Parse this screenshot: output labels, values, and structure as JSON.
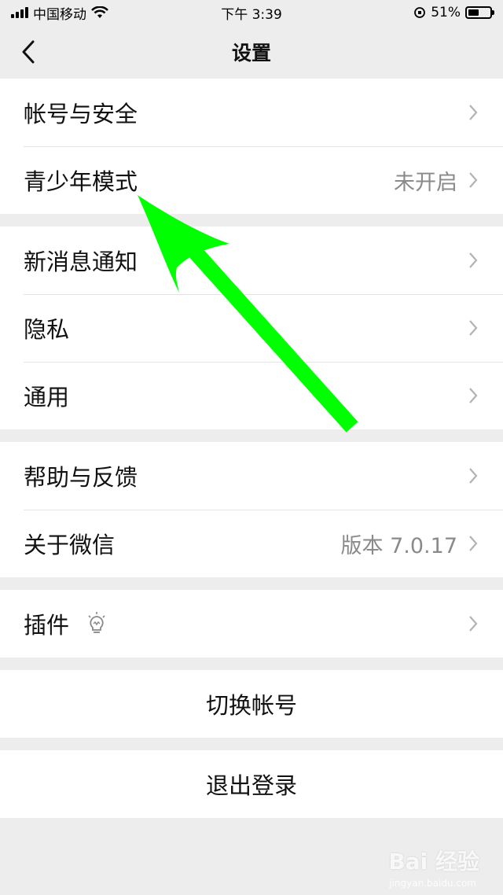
{
  "status_bar": {
    "carrier": "中国移动",
    "time": "下午 3:39",
    "battery_percent": "51%",
    "battery_level": 0.51
  },
  "nav": {
    "title": "设置"
  },
  "groups": [
    {
      "items": [
        {
          "label": "帐号与安全",
          "value": ""
        },
        {
          "label": "青少年模式",
          "value": "未开启"
        }
      ]
    },
    {
      "items": [
        {
          "label": "新消息通知",
          "value": ""
        },
        {
          "label": "隐私",
          "value": ""
        },
        {
          "label": "通用",
          "value": ""
        }
      ]
    },
    {
      "items": [
        {
          "label": "帮助与反馈",
          "value": ""
        },
        {
          "label": "关于微信",
          "value": "版本 7.0.17"
        }
      ]
    },
    {
      "items": [
        {
          "label": "插件",
          "value": ""
        }
      ]
    }
  ],
  "actions": {
    "switch_account": "切换帐号",
    "logout": "退出登录"
  },
  "watermark": {
    "text": "Bai 经验",
    "sub": "jingyan.baidu.com"
  },
  "colors": {
    "background": "#ededed",
    "arrow": "#00ff00",
    "secondary_text": "#8a8a8a"
  },
  "icons": [
    "back-icon",
    "chevron-right-icon",
    "lightbulb-icon",
    "wifi-icon",
    "battery-icon",
    "signal-icon"
  ]
}
